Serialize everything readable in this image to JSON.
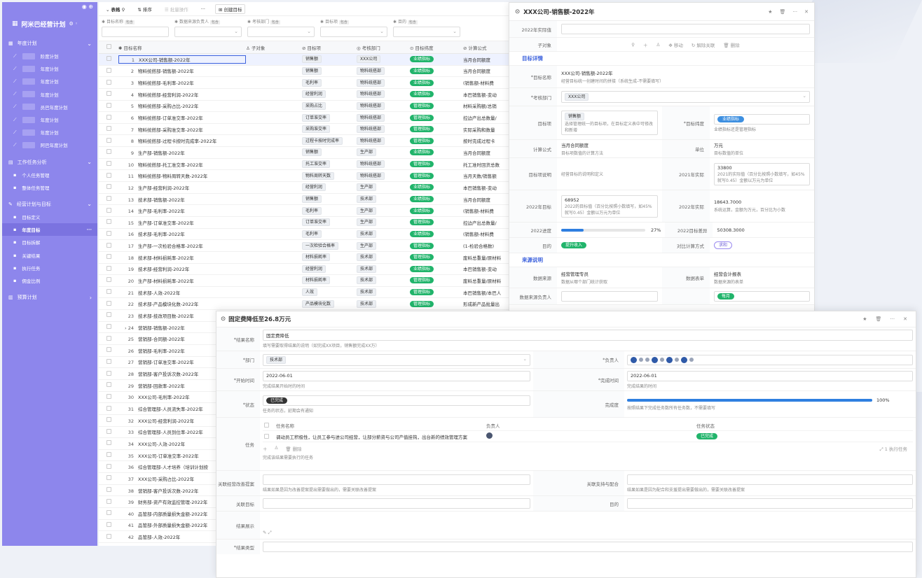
{
  "sidebar": {
    "brand": "阿米巴经营计划",
    "groups": [
      {
        "label": "年度计划",
        "items": [
          "阶度计划",
          "年度计划",
          "年度计划",
          "年度计划",
          "员巴年度计划",
          "年度计划",
          "年度计划",
          "阿巴年度计划"
        ]
      },
      {
        "label": "工作任务分析",
        "items": [
          "个人任务管理",
          "整体任务管理"
        ]
      },
      {
        "label": "经营计划与目标",
        "items": [
          "目标定义",
          "年度目标",
          "目标拆解",
          "关键结果",
          "执行任务",
          "佣金比例"
        ]
      },
      {
        "label": "预算计划",
        "items": []
      }
    ]
  },
  "toolbar": {
    "view": "表格",
    "sort": "排序",
    "batch": "批量操作",
    "more": "···",
    "create": "创建目标"
  },
  "filters": [
    {
      "label": "目标名称",
      "tag": "包含"
    },
    {
      "label": "数据来源负责人",
      "tag": "包含"
    },
    {
      "label": "考核部门",
      "tag": "包含"
    },
    {
      "label": "目标项",
      "tag": "包含"
    },
    {
      "label": "目的",
      "tag": "包含"
    }
  ],
  "table": {
    "headers": [
      "目标名称",
      "子对象",
      "目标项",
      "考核部门",
      "目标纬度",
      "计算公式"
    ],
    "rows": [
      {
        "n": "1",
        "name": "XXX公司-销售额-2022年",
        "tgt": "销售额",
        "dept": "XXX公司",
        "dim": "业绩指标",
        "form": "当月合同额度"
      },
      {
        "n": "2",
        "name": "物料统搭部-销售额-2022年",
        "tgt": "销售额",
        "dept": "物料统搭部",
        "dim": "业绩指标",
        "form": "当月合同额度"
      },
      {
        "n": "3",
        "name": "物料统搭部-毛利率-2022年",
        "tgt": "毛利率",
        "dept": "物料统搭部",
        "dim": "业绩指标",
        "form": "(销售额-材料费"
      },
      {
        "n": "4",
        "name": "物料统搭部-经营利润-2022年",
        "tgt": "经营利润",
        "dept": "物料统搭部",
        "dim": "业绩指标",
        "form": "本巴销售额-变动"
      },
      {
        "n": "5",
        "name": "物料统搭部-采购占比-2022年",
        "tgt": "采购占比",
        "dept": "物料统搭部",
        "dim": "管理指标",
        "form": "材料采购额/总销"
      },
      {
        "n": "6",
        "name": "物料统搭部-订单准交率-2022年",
        "tgt": "订单准交率",
        "dept": "物料统搭部",
        "dim": "管理指标",
        "form": "控边产出总数量/"
      },
      {
        "n": "7",
        "name": "物料统搭部-采购准交率-2022年",
        "tgt": "采购准交率",
        "dept": "物料统搭部",
        "dim": "管理指标",
        "form": "实际采购和数量"
      },
      {
        "n": "8",
        "name": "物料统搭部-过程卡按时完成率-2022年",
        "tgt": "过程卡按时完成率",
        "dept": "物料统搭部",
        "dim": "管理指标",
        "form": "按时完成过程卡"
      },
      {
        "n": "9",
        "name": "生产部-销售额-2022年",
        "tgt": "销售额",
        "dept": "生产部",
        "dim": "业绩指标",
        "form": "当月合同额度"
      },
      {
        "n": "10",
        "name": "物料统搭部-托工准交率-2022年",
        "tgt": "托工准交率",
        "dept": "物料统搭部",
        "dim": "管理指标",
        "form": "托工准时回货总数"
      },
      {
        "n": "11",
        "name": "物料统搭部-物料周转天数-2022年",
        "tgt": "物料周转天数",
        "dept": "物料统搭部",
        "dim": "管理指标",
        "form": "当月天数/销售额"
      },
      {
        "n": "12",
        "name": "生产部-经营利润-2022年",
        "tgt": "经营利润",
        "dept": "生产部",
        "dim": "业绩指标",
        "form": "本巴销售额-变动"
      },
      {
        "n": "13",
        "name": "技术部-销售额-2022年",
        "tgt": "销售额",
        "dept": "技术部",
        "dim": "业绩指标",
        "form": "当月合同额度"
      },
      {
        "n": "14",
        "name": "生产部-毛利率-2022年",
        "tgt": "毛利率",
        "dept": "生产部",
        "dim": "业绩指标",
        "form": "(销售额-材料费"
      },
      {
        "n": "15",
        "name": "生产部-订单准交率-2022年",
        "tgt": "订单准交率",
        "dept": "生产部",
        "dim": "管理指标",
        "form": "控边产出总数量/"
      },
      {
        "n": "16",
        "name": "技术部-毛利率-2022年",
        "tgt": "毛利率",
        "dept": "技术部",
        "dim": "业绩指标",
        "form": "(销售额-材料费"
      },
      {
        "n": "17",
        "name": "生产部-一次检验合格率-2022年",
        "tgt": "一次检验合格率",
        "dept": "生产部",
        "dim": "管理指标",
        "form": "(1-检验合格数)"
      },
      {
        "n": "18",
        "name": "技术部-材料损耗率-2022年",
        "tgt": "材料损耗率",
        "dept": "技术部",
        "dim": "管理指标",
        "form": "废料总重量/原材料"
      },
      {
        "n": "19",
        "name": "技术部-经营利润-2022年",
        "tgt": "经营利润",
        "dept": "技术部",
        "dim": "业绩指标",
        "form": "本巴销售额-变动"
      },
      {
        "n": "20",
        "name": "生产部-材料损耗率-2022年",
        "tgt": "材料损耗率",
        "dept": "技术部",
        "dim": "管理指标",
        "form": "废料总重量/原材料"
      },
      {
        "n": "21",
        "name": "技术部-人效-2022年",
        "tgt": "人效",
        "dept": "技术部",
        "dim": "管理指标",
        "form": "本巴销售额/本巴人"
      },
      {
        "n": "22",
        "name": "技术部-产品模块化数-2022年",
        "tgt": "产品模块化数",
        "dept": "技术部",
        "dim": "管理指标",
        "form": "形成新产品批量出"
      },
      {
        "n": "23",
        "name": "技术部-技改项目数-2022年",
        "tgt": "",
        "dept": "",
        "dim": "",
        "form": ""
      },
      {
        "n": "24",
        "name": "营销部-销售额-2022年",
        "tgt": "",
        "dept": "",
        "dim": "",
        "form": ""
      },
      {
        "n": "25",
        "name": "营销部-合同额-2022年",
        "tgt": "",
        "dept": "",
        "dim": "",
        "form": ""
      },
      {
        "n": "26",
        "name": "营销部-毛利率-2022年",
        "tgt": "",
        "dept": "",
        "dim": "",
        "form": ""
      },
      {
        "n": "27",
        "name": "营销部-订单准交率-2022年",
        "tgt": "",
        "dept": "",
        "dim": "",
        "form": ""
      },
      {
        "n": "28",
        "name": "营销部-客户投诉次数-2022年",
        "tgt": "",
        "dept": "",
        "dim": "",
        "form": ""
      },
      {
        "n": "29",
        "name": "营销部-回款率-2022年",
        "tgt": "",
        "dept": "",
        "dim": "",
        "form": ""
      },
      {
        "n": "30",
        "name": "XXX公司-毛利率-2022年",
        "tgt": "",
        "dept": "",
        "dim": "",
        "form": ""
      },
      {
        "n": "31",
        "name": "综合管理部-人员流失率-2022年",
        "tgt": "",
        "dept": "",
        "dim": "",
        "form": ""
      },
      {
        "n": "32",
        "name": "XXX公司-经营利润-2022年",
        "tgt": "",
        "dept": "",
        "dim": "",
        "form": ""
      },
      {
        "n": "33",
        "name": "综合管理部-人员到位率-2022年",
        "tgt": "",
        "dept": "",
        "dim": "",
        "form": ""
      },
      {
        "n": "34",
        "name": "XXX公司-人效-2022年",
        "tgt": "",
        "dept": "",
        "dim": "",
        "form": ""
      },
      {
        "n": "35",
        "name": "XXX公司-订单准交率-2022年",
        "tgt": "",
        "dept": "",
        "dim": "",
        "form": ""
      },
      {
        "n": "36",
        "name": "综合管理部-人才培养（培训计划按",
        "tgt": "",
        "dept": "",
        "dim": "",
        "form": ""
      },
      {
        "n": "37",
        "name": "XXX公司-采购占比-2022年",
        "tgt": "",
        "dept": "",
        "dim": "",
        "form": ""
      },
      {
        "n": "38",
        "name": "营销部-客户投诉次数-2022年",
        "tgt": "",
        "dept": "",
        "dim": "",
        "form": ""
      },
      {
        "n": "39",
        "name": "财务部-资产有效监控管理-2022年",
        "tgt": "",
        "dept": "",
        "dim": "",
        "form": ""
      },
      {
        "n": "40",
        "name": "品管部-内部质量损失金额-2022年",
        "tgt": "",
        "dept": "",
        "dim": "",
        "form": ""
      },
      {
        "n": "41",
        "name": "品管部-外部质量损失金额-2022年",
        "tgt": "",
        "dept": "",
        "dim": "",
        "form": ""
      },
      {
        "n": "42",
        "name": "品管部-人效-2022年",
        "tgt": "",
        "dept": "",
        "dim": "",
        "form": ""
      }
    ]
  },
  "detail": {
    "title": "XXX公司-销售额-2022年",
    "actual_label": "2022年实际值",
    "child_label": "子对象",
    "child_actions": [
      "移动",
      "解除关联",
      "删除"
    ],
    "section1": "目标详情",
    "name_label": "目标名称",
    "name_value": "XXX公司-销售额-2022年",
    "name_hint": "经营目标统一创建时间的拼接（系统生成-不需要填写）",
    "dept_label": "考核部门",
    "dept_value": "XXX公司",
    "item_label": "目标项",
    "item_value": "销售额",
    "item_hint": "选择管理统一的目标项，在目标定义表中可修改和新增",
    "dim_label": "目标纬度",
    "dim_value": "业绩指标",
    "dim_hint": "业绩指标还是管理指标",
    "formula_label": "计算公式",
    "formula_value": "当月合同额度",
    "formula_hint": "目标项数值的计算方法",
    "unit_label": "单位",
    "unit_value": "万元",
    "unit_hint": "目标数值的单位",
    "desc_label": "目标项说明",
    "desc_hint": "经营目标的说明和定义",
    "a2021_label": "2021年实际",
    "a2021_value": "33800",
    "a2021_hint": "2021的实际值（百分比按照小数填写，如45%就写0.45）金额以万元为单位",
    "t2022_label": "2022年目标",
    "t2022_value": "68952",
    "t2022_hint": "2022的目标值（百分比按照小数填写，如45%就写0.45）金额以万元为单位",
    "a2022_label": "2022年实际",
    "a2022_value": "18643.7000",
    "a2022_hint": "系统运算，金额为万元，百分比为小数",
    "prog_label": "2022进度",
    "prog_value": "27%",
    "prog_fraction": 0.27,
    "diff_label": "2022目标差异",
    "diff_value": "50308.3000",
    "purpose_label": "目的",
    "purpose_value": "提升收入",
    "ratio_label": "对比计算方式",
    "ratio_value": "求和",
    "section2": "来源说明",
    "src_label": "数据来源",
    "src_value": "经营管理专员",
    "src_hint": "数据从哪个部门统计获取",
    "tbl_label": "数据表单",
    "tbl_value": "经营会计报表",
    "tbl_hint": "数据来源的表单",
    "owner_label": "数据来源负责人",
    "freq_value": "每月"
  },
  "bottom": {
    "title": "固定费降低至26.8万元",
    "result_label": "结果名称",
    "result_value": "固定费降低",
    "result_hint": "填写需要取得结果的说明（如完成XX项目，销售额完成XX万）",
    "dept_label": "部门",
    "dept_value": "技术部",
    "owner_label": "负责人",
    "start_label": "开始时间",
    "start_value": "2022-06-01",
    "start_hint": "完成结果开始时的时间",
    "end_label": "完成时间",
    "end_value": "2022-06-01",
    "end_hint": "完成结果的时间",
    "status_label": "状态",
    "status_value": "已完成",
    "status_hint": "任务的状态，延期会有通知",
    "done_label": "完成度",
    "done_value": "100%",
    "done_fraction": 1.0,
    "done_hint": "按照结果下完成任务数所有任务数，不需要填写",
    "task_label": "任务",
    "task_col1": "任务名称",
    "task_col2": "负责人",
    "task_col3": "任务状态",
    "task_name": "调动员工积极性，让员工参与进公司经营，让部分薪资与公司产值挂钩，出台新的绩效管理方案",
    "task_status": "已完成",
    "task_delete": "删除",
    "task_hint": "完成该结果需要执行的任务",
    "task_count": "1 执行任务",
    "plan_label": "关联经营改善提案",
    "plan_hint": "结果如果是因为改善提案提出需要做出的，需要关联改善提案",
    "support_label": "关联支持与配合",
    "support_hint": "结果如果是因为配合和支援提出需要做出的，需要关联改善提案",
    "goal_label": "关联目标",
    "purpose_label": "目的",
    "show_label": "结果展示",
    "type_label": "结果类型"
  },
  "colors": {
    "sidebar": "#8d86ec",
    "accent": "#3e63dd",
    "success": "#21b46b"
  }
}
